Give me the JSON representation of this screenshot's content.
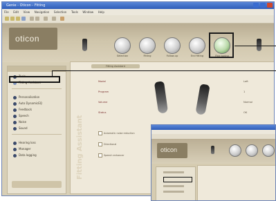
{
  "window": {
    "title": "Genie - Oticon - Fitting"
  },
  "menu": [
    "File",
    "Edit",
    "View",
    "Navigation",
    "Selection",
    "Tools",
    "Window",
    "Help"
  ],
  "brand": {
    "logo_text": "oticon"
  },
  "nav": [
    {
      "label": "Selection"
    },
    {
      "label": "Fitting"
    },
    {
      "label": "Follow-up"
    },
    {
      "label": "End fitting"
    },
    {
      "label": "Fine tuning",
      "active": true
    }
  ],
  "sidebar": {
    "items": [
      {
        "label": "Tools"
      },
      {
        "label": "Fitting Assistant",
        "selected": true
      },
      {
        "label": "Personalisation"
      },
      {
        "label": "Auto DynamicEQ"
      },
      {
        "label": "Feedback"
      },
      {
        "label": "Speech"
      },
      {
        "label": "Noise"
      },
      {
        "label": "Sound"
      }
    ],
    "footer_items": [
      {
        "label": "Hearing loss"
      },
      {
        "label": "Manager"
      },
      {
        "label": "Data logging"
      }
    ]
  },
  "main": {
    "tab_label": "Fitting Assistant",
    "side_title": "Fitting Assistant",
    "rows": [
      {
        "label": "Model",
        "value": "Left"
      },
      {
        "label": "Program",
        "value": "1"
      },
      {
        "label": "Volume",
        "value": "Normal"
      },
      {
        "label": "Status",
        "value": "OK"
      }
    ],
    "checks": [
      {
        "label": "Automatic noise reduction"
      },
      {
        "label": "Directional"
      },
      {
        "label": "Speech enhancer"
      }
    ]
  }
}
